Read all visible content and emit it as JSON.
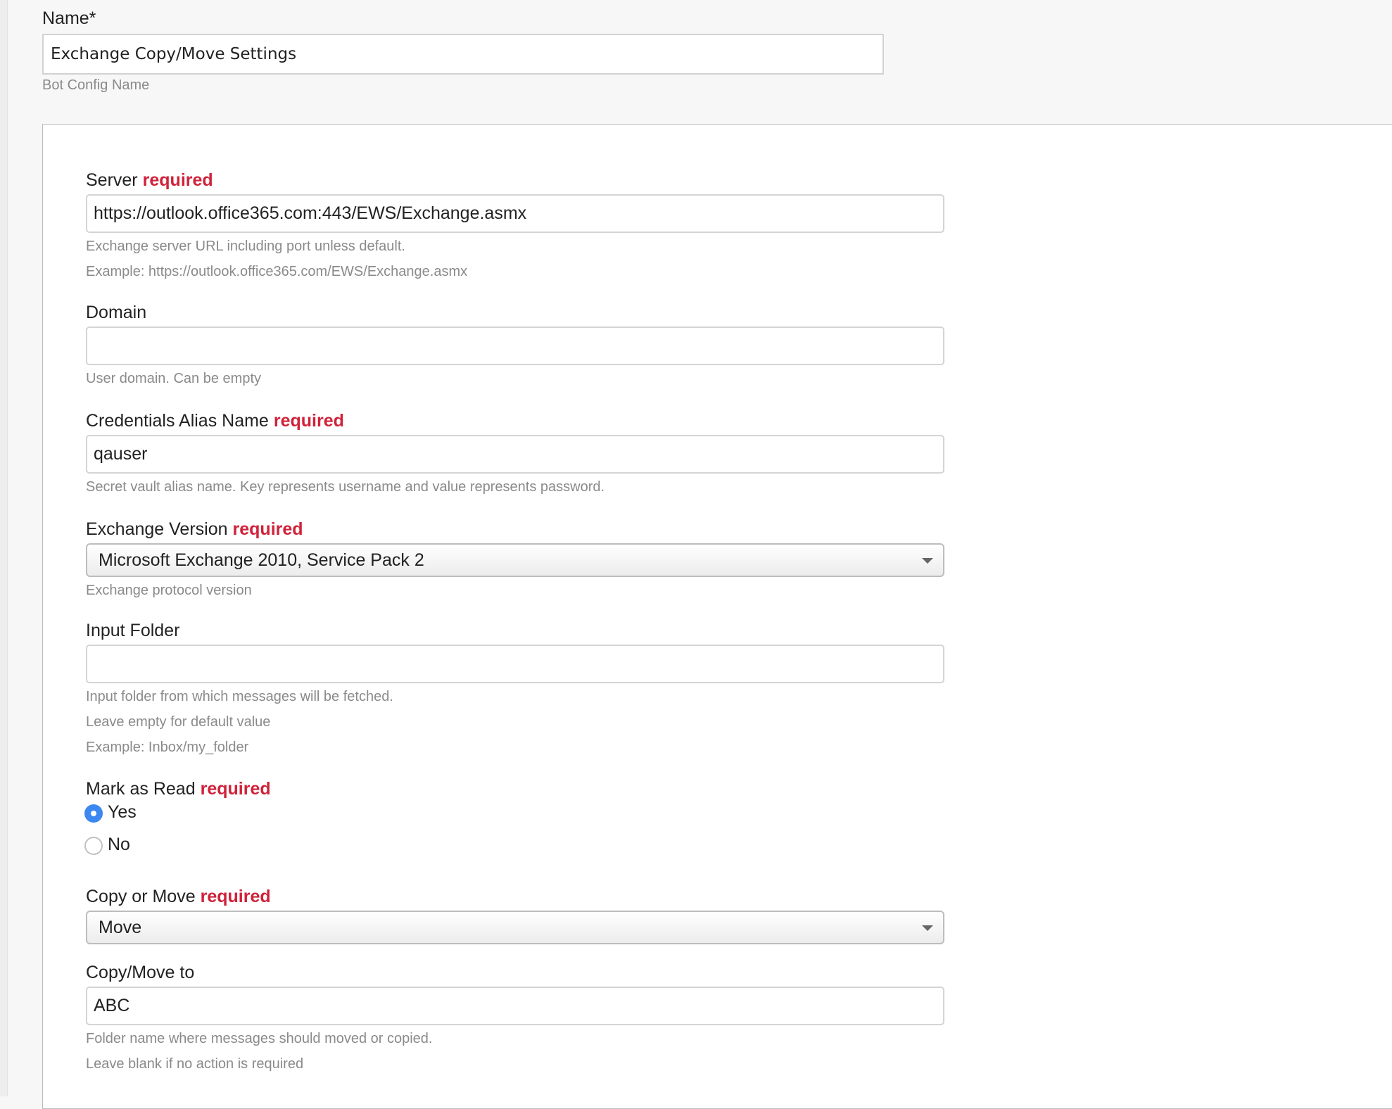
{
  "config": {
    "name_label": "Name*",
    "name_value": "Exchange Copy/Move Settings",
    "name_help": "Bot Config Name"
  },
  "required_text": "required",
  "fields": {
    "server": {
      "label": "Server",
      "value": "https://outlook.office365.com:443/EWS/Exchange.asmx",
      "help": [
        "Exchange server URL including port unless default.",
        "Example: https://outlook.office365.com/EWS/Exchange.asmx"
      ]
    },
    "domain": {
      "label": "Domain",
      "value": "",
      "help": [
        "User domain. Can be empty"
      ]
    },
    "credentials": {
      "label": "Credentials Alias Name",
      "value": "qauser",
      "help": [
        "Secret vault alias name. Key represents username and value represents password."
      ]
    },
    "exchange_version": {
      "label": "Exchange Version",
      "selected": "Microsoft Exchange 2010, Service Pack 2",
      "help": [
        "Exchange protocol version"
      ]
    },
    "input_folder": {
      "label": "Input Folder",
      "value": "",
      "help": [
        "Input folder from which messages will be fetched.",
        "Leave empty for default value",
        "Example: Inbox/my_folder"
      ]
    },
    "mark_as_read": {
      "label": "Mark as Read",
      "options": [
        {
          "label": "Yes",
          "checked": true
        },
        {
          "label": "No",
          "checked": false
        }
      ]
    },
    "copy_or_move": {
      "label": "Copy or Move",
      "selected": "Move"
    },
    "copy_move_to": {
      "label": "Copy/Move to",
      "value": "ABC",
      "help": [
        "Folder name where messages should moved or copied.",
        "Leave blank if no action is required"
      ]
    }
  },
  "colors": {
    "required": "#d0223a",
    "radio_checked": "#3c87f0",
    "help_text": "#8a8a8a"
  }
}
